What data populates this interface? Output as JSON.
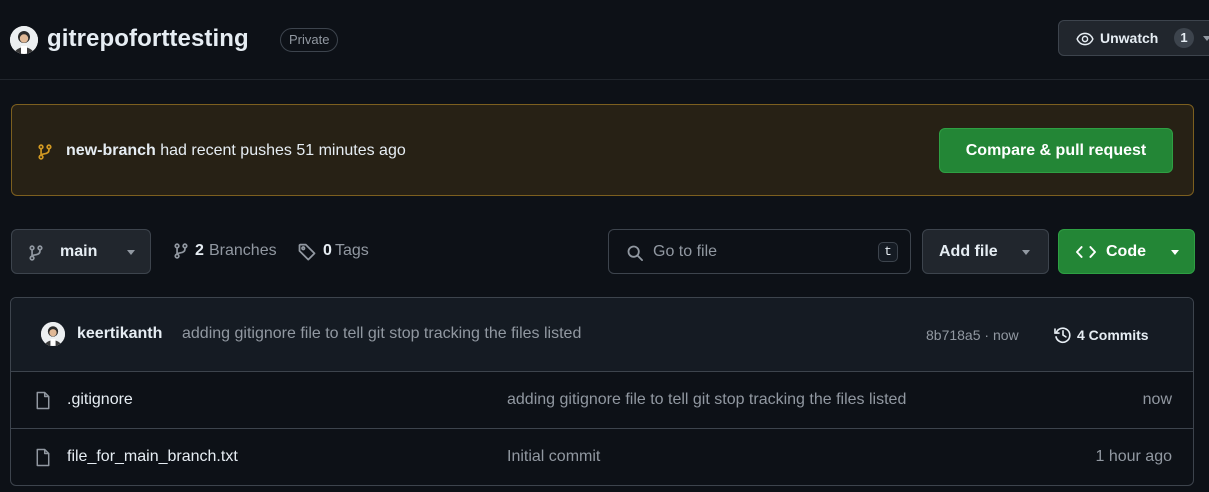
{
  "repo": {
    "name": "gitrepoforttesting",
    "visibility": "Private",
    "watch": {
      "label": "Unwatch",
      "count": "1"
    }
  },
  "banner": {
    "branch": "new-branch",
    "message": " had recent pushes 51 minutes ago",
    "action": "Compare & pull request"
  },
  "toolbar": {
    "current_branch": "main",
    "branches_count": "2",
    "branches_label": " Branches",
    "tags_count": "0",
    "tags_label": " Tags",
    "search_placeholder": "Go to file",
    "search_shortcut": "t",
    "add_file": "Add file",
    "code": "Code"
  },
  "latest_commit": {
    "author": "keertikanth",
    "message": "adding gitignore file to tell git stop tracking the files listed",
    "sha_time": "8b718a5 · now",
    "commits_label": "4 Commits"
  },
  "files": [
    {
      "name": ".gitignore",
      "commit": "adding gitignore file to tell git stop tracking the files listed",
      "age": "now"
    },
    {
      "name": "file_for_main_branch.txt",
      "commit": "Initial commit",
      "age": "1 hour ago"
    }
  ],
  "colors": {
    "background": "#0d1117",
    "primary_button": "#238636",
    "banner_bg": "#272115",
    "banner_border": "#7c5f1f",
    "branch_icon": "#d29922",
    "muted_text": "#9198a1"
  },
  "icons": [
    "eye-icon",
    "git-branch-icon",
    "tag-icon",
    "search-icon",
    "code-icon",
    "history-icon",
    "file-icon",
    "chevron-down-icon"
  ]
}
